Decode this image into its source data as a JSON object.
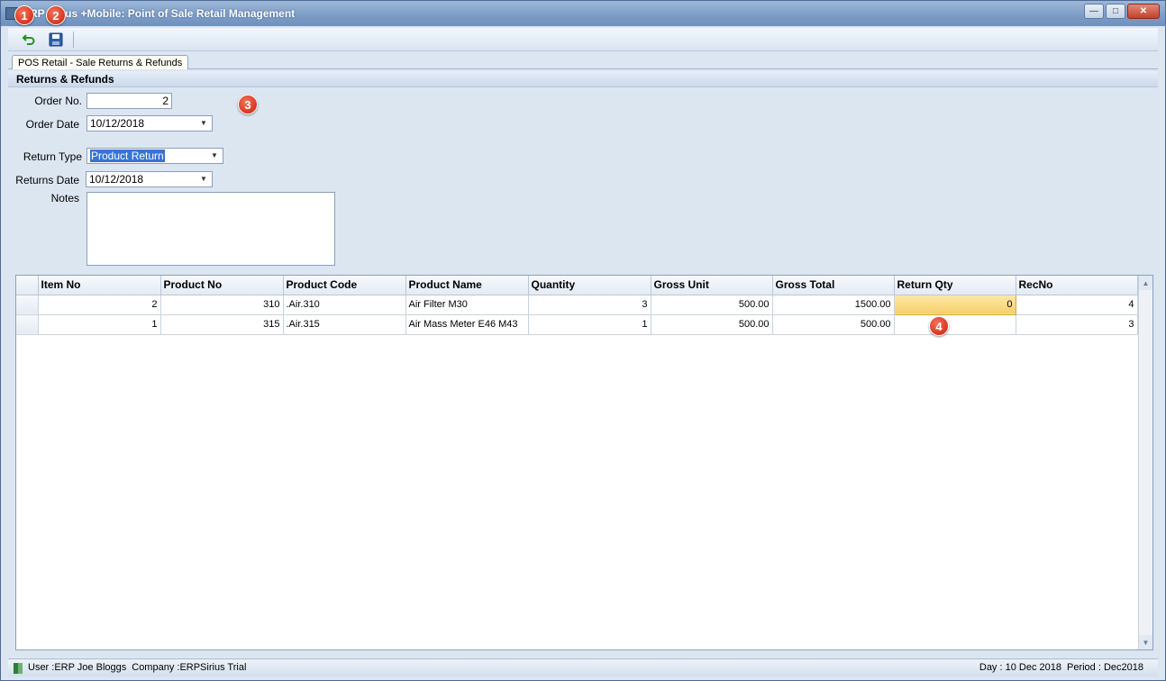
{
  "window": {
    "title": "ERP Sirius +Mobile: Point of Sale Retail Management"
  },
  "toolbar": {
    "back_icon": "return-arrow-icon",
    "save_icon": "floppy-disk-icon"
  },
  "tab": {
    "label": "POS Retail - Sale Returns & Refunds"
  },
  "section": {
    "title": "Returns & Refunds"
  },
  "form": {
    "order_no_label": "Order No.",
    "order_no_value": "2",
    "order_date_label": "Order Date",
    "order_date_value": "10/12/2018",
    "return_type_label": "Return Type",
    "return_type_value": "Product Return",
    "returns_date_label": "Returns Date",
    "returns_date_value": "10/12/2018",
    "notes_label": "Notes",
    "notes_value": ""
  },
  "badges": [
    "1",
    "2",
    "3",
    "4"
  ],
  "grid": {
    "columns": [
      "Item No",
      "Product No",
      "Product Code",
      "Product Name",
      "Quantity",
      "Gross Unit",
      "Gross Total",
      "Return Qty",
      "RecNo"
    ],
    "rows": [
      [
        "2",
        "310",
        ".Air.310",
        "Air Filter M30",
        "3",
        "500.00",
        "1500.00",
        "0",
        "4"
      ],
      [
        "1",
        "315",
        ".Air.315",
        "Air Mass Meter E46 M43",
        "1",
        "500.00",
        "500.00",
        "",
        "3"
      ]
    ]
  },
  "status": {
    "user": "User :ERP Joe Bloggs",
    "company": "Company :ERPSirius Trial",
    "day": "Day : 10 Dec 2018",
    "period": "Period : Dec2018"
  },
  "colors": {
    "titlebar": "#7c9cc6",
    "panel": "#dce6f1",
    "badge": "#d8341e",
    "selection": "#3874d0",
    "highlight_cell": "#f5cf6a"
  }
}
